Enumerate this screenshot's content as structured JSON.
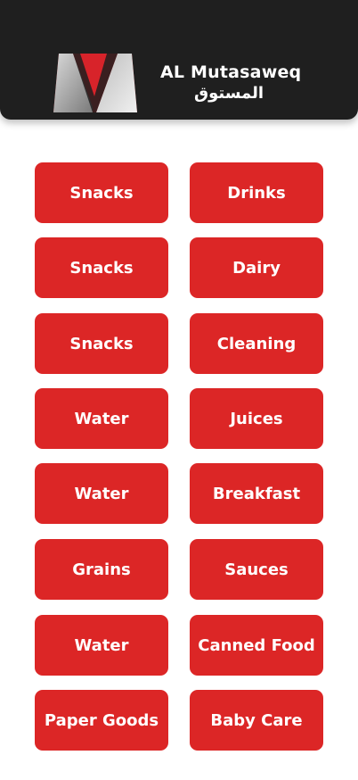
{
  "header": {
    "brand_name": "AL Mutasaweq",
    "brand_name_arabic": "المستوق",
    "logo_colors": {
      "red": "#d8232a",
      "gray": "#9a9a9a",
      "light": "#e5e5e5"
    }
  },
  "categories": [
    "Snacks",
    "Drinks",
    "Snacks",
    "Dairy",
    "Snacks",
    "Cleaning",
    "Water",
    "Juices",
    "Water",
    "Breakfast",
    "Grains",
    "Sauces",
    "Water",
    "Canned Food",
    "Paper Goods",
    "Baby Care"
  ],
  "colors": {
    "accent": "#dc2626",
    "header_bg": "#1f1f1f",
    "button_text": "#ffffff"
  }
}
